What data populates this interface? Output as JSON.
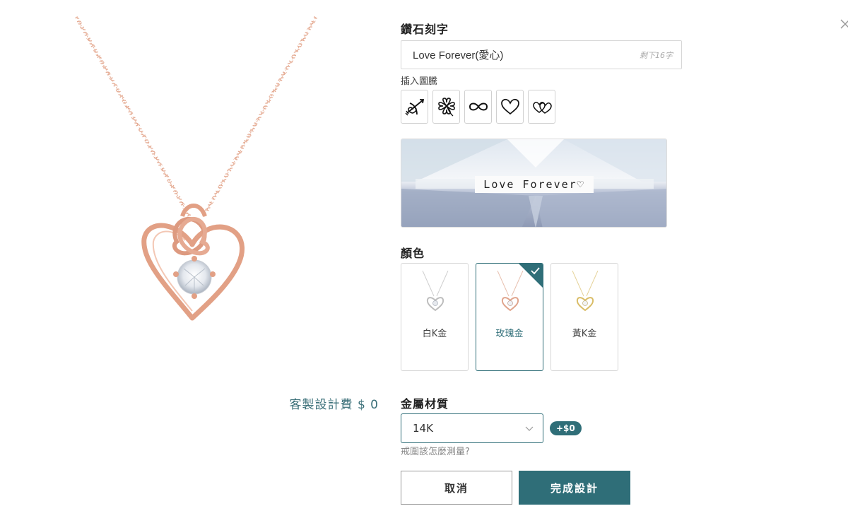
{
  "price": {
    "label": "客製設計費 $ 0"
  },
  "engraving": {
    "title": "鑽石刻字",
    "value": "Love Forever(愛心)",
    "remaining": "剩下16字",
    "symbols_label": "插入圖騰",
    "symbols": [
      "cupid-arrow",
      "four-leaf-clover",
      "infinity",
      "heart",
      "double-heart"
    ]
  },
  "preview": {
    "text": "Love Forever♡"
  },
  "color": {
    "title": "顏色",
    "options": [
      {
        "label": "白K金",
        "selected": false,
        "tint": "#c9c9c9"
      },
      {
        "label": "玫瑰金",
        "selected": true,
        "tint": "#e0ad94"
      },
      {
        "label": "黃K金",
        "selected": false,
        "tint": "#dcc277"
      }
    ]
  },
  "material": {
    "title": "金屬材質",
    "selected": "14K",
    "price_delta": "+$0",
    "help_link": "戒圍該怎麼測量?"
  },
  "actions": {
    "cancel": "取消",
    "finish": "完成設計"
  },
  "colors": {
    "accent": "#2f6e78",
    "rose_gold": "#e0a48c",
    "border": "#d7d7d7"
  }
}
